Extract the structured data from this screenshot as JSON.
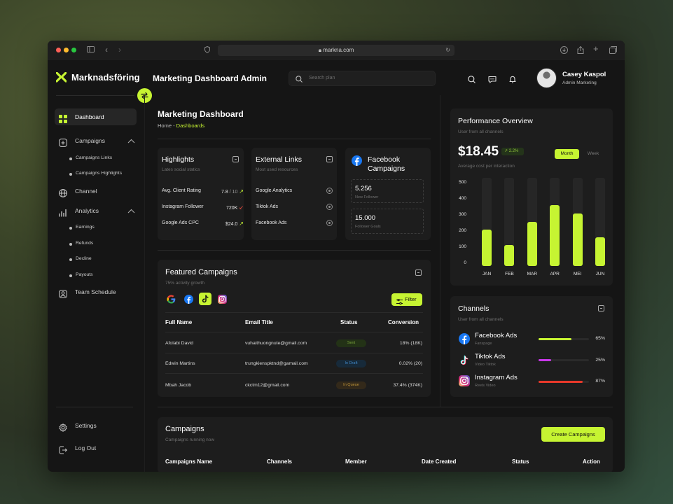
{
  "browser": {
    "url": "markna.com"
  },
  "brand": {
    "name": "Marknadsföring",
    "accent": "#c6f432"
  },
  "header": {
    "title": "Marketing Dashboard Admin",
    "search_placeholder": "Search plan",
    "user": {
      "name": "Casey Kaspol",
      "role": "Admin Marketing"
    }
  },
  "sidebar": {
    "dashboard": "Dashboard",
    "campaigns": "Campaigns",
    "campaigns_sub": [
      "Campaigns Links",
      "Campaigns Highlights"
    ],
    "channel": "Channel",
    "analytics": "Analytics",
    "analytics_sub": [
      "Earnings",
      "Refunds",
      "Decline",
      "Payouts"
    ],
    "team_schedule": "Team Schedule",
    "settings": "Settings",
    "logout": "Log Out"
  },
  "main": {
    "title": "Marketing Dashboard",
    "breadcrumb_home": "Home - ",
    "breadcrumb_current": "Dashboards"
  },
  "highlights": {
    "title": "Highlights",
    "subtitle": "Lates social statics",
    "rows": [
      {
        "label": "Avg. Client Rating",
        "value": "7.8",
        "suffix": " / 10",
        "trend": "up"
      },
      {
        "label": "Instagram Follower",
        "value": "720K",
        "suffix": "",
        "trend": "down"
      },
      {
        "label": "Google Ads CPC",
        "value": "$24.0",
        "suffix": "",
        "trend": "up"
      }
    ]
  },
  "external_links": {
    "title": "External Links",
    "subtitle": "Most used resources",
    "items": [
      "Google Analytics",
      "Tiktok Ads",
      "Facebook Ads"
    ]
  },
  "facebook_campaigns": {
    "title_line1": "Facebook",
    "title_line2": "Campaigns",
    "stats": [
      {
        "value": "5.256",
        "label": "New Follower"
      },
      {
        "value": "15.000",
        "label": "Follower Goals"
      }
    ]
  },
  "featured": {
    "title": "Featured Campaigns",
    "subtitle": "75% activity growth",
    "filter_label": "Filter",
    "columns": [
      "Full Name",
      "Email Title",
      "Status",
      "Conversion"
    ],
    "rows": [
      {
        "name": "Afolabi David",
        "email": "vuhaithuongnute@gmail.com",
        "status": "Sent",
        "conversion": "18% (18K)"
      },
      {
        "name": "Edwin Martins",
        "email": "trungkienspktnd@gamail.com",
        "status": "In Draft",
        "conversion": "0.02% (20)"
      },
      {
        "name": "Mbah Jacob",
        "email": "ckctm12@gmail.com",
        "status": "In Queue",
        "conversion": "37.4% (374K)"
      }
    ],
    "status_colors": {
      "Sent": "#5d8f2a",
      "In Draft": "#3a79b0",
      "In Queue": "#a8822c"
    }
  },
  "performance": {
    "title": "Performance Overview",
    "subtitle": "User from all channels",
    "amount": "$18.45",
    "badge": "2.2%",
    "caption": "Average cost per interaction",
    "tabs": [
      "Month",
      "Week"
    ]
  },
  "chart_data": {
    "type": "bar",
    "categories": [
      "JAN",
      "FEB",
      "MAR",
      "APR",
      "MEI",
      "JUN"
    ],
    "values": [
      225,
      130,
      275,
      380,
      325,
      180
    ],
    "yticks": [
      "500",
      "400",
      "300",
      "200",
      "100",
      "0"
    ],
    "ylim": [
      0,
      500
    ]
  },
  "channels": {
    "title": "Channels",
    "subtitle": "User from all channels",
    "items": [
      {
        "name": "Facebook Ads",
        "sub": "Fanspage",
        "percent": "65%",
        "fraction": 0.65,
        "color": "#c6f432"
      },
      {
        "name": "Tiktok Ads",
        "sub": "Video Tiktok",
        "percent": "25%",
        "fraction": 0.25,
        "color": "#c837e8"
      },
      {
        "name": "Instagram Ads",
        "sub": "Reels Video",
        "percent": "87%",
        "fraction": 0.87,
        "color": "#e8382a"
      }
    ]
  },
  "campaigns_table": {
    "title": "Campaigns",
    "subtitle": "Campaigns running now",
    "create_label": "Create Campaigns",
    "columns": [
      "Campaigns Name",
      "Channels",
      "Member",
      "Date Created",
      "Status",
      "Action"
    ]
  }
}
